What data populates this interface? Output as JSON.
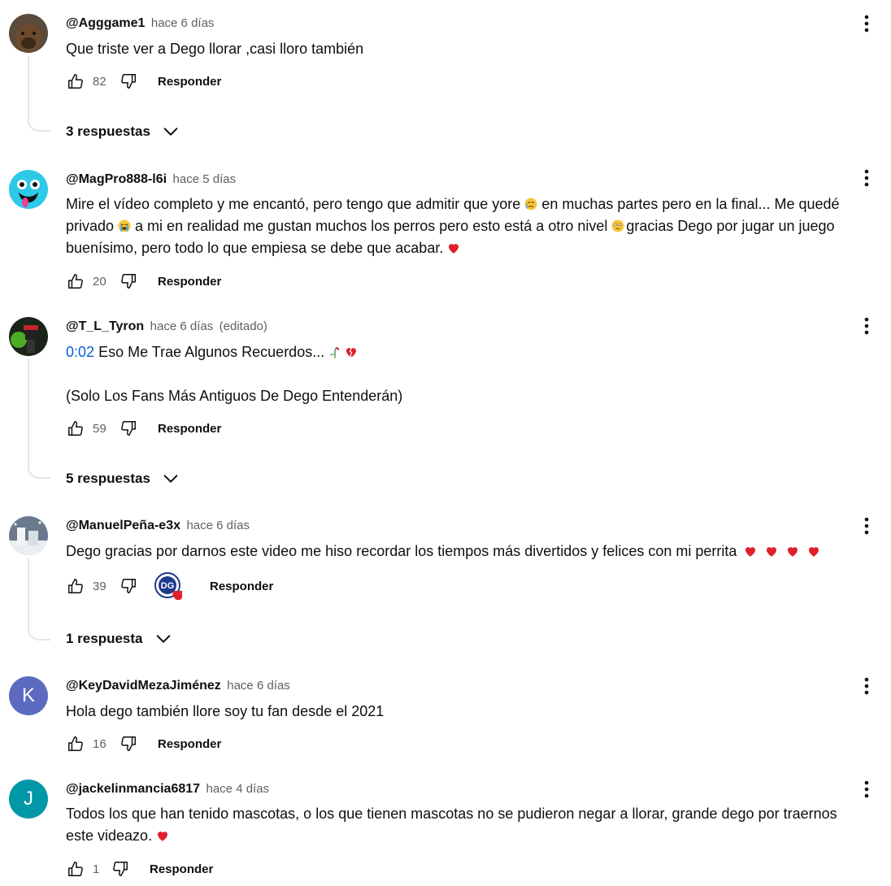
{
  "ui": {
    "reply_label": "Responder",
    "like_icon": "thumb-up-icon",
    "dislike_icon": "thumb-down-icon",
    "more_icon": "more-vert-icon"
  },
  "comments": [
    {
      "author": "@Agggame1",
      "time": "hace 6 días",
      "text": "Que triste ver a Dego llorar ,casi lloro también",
      "likes": "82",
      "replies": "3 respuestas"
    },
    {
      "author": "@MagPro888-l6i",
      "time": "hace 5 días",
      "line1a": "Mire el vídeo completo y me encantó, pero tengo que admitir que yore",
      "line1b": "en muchas partes pero en la final... Me quedé",
      "line2a": "privado",
      "line2b": "a mi en realidad me gustan muchos los perros pero esto está a otro nivel",
      "line2c": "gracias Dego por jugar un juego",
      "line3": "buenísimo, pero todo lo que empiesa se debe que acabar.",
      "likes": "20"
    },
    {
      "author": "@T_L_Tyron",
      "time": "hace 6 días",
      "edited": "(editado)",
      "timestamp": "0:02",
      "text1": "Eso Me Trae Algunos Recuerdos...",
      "text2": "(Solo Los  Fans Más Antiguos De Dego Entenderán)",
      "likes": "59",
      "replies": "5 respuestas"
    },
    {
      "author": "@ManuelPeña-e3x",
      "time": "hace 6 días",
      "text": "Dego gracias por darnos este video  me hiso recordar los tiempos más divertidos y felices con mi perrita",
      "likes": "39",
      "creator_badge": "DG",
      "replies": "1 respuesta"
    },
    {
      "author": "@KeyDavidMezaJiménez",
      "time": "hace 6 días",
      "avatar_letter": "K",
      "avatar_color": "#5c6bc0",
      "text": "Hola dego también llore soy tu fan desde el 2021",
      "likes": "16"
    },
    {
      "author": "@jackelinmancia6817",
      "time": "hace 4 días",
      "avatar_letter": "J",
      "avatar_color": "#0097a7",
      "line1": "Todos los que han tenido mascotas, o los que tienen mascotas no se pudieron negar a llorar, grande dego por traernos",
      "line2": "este videazo.",
      "likes": "1"
    }
  ]
}
